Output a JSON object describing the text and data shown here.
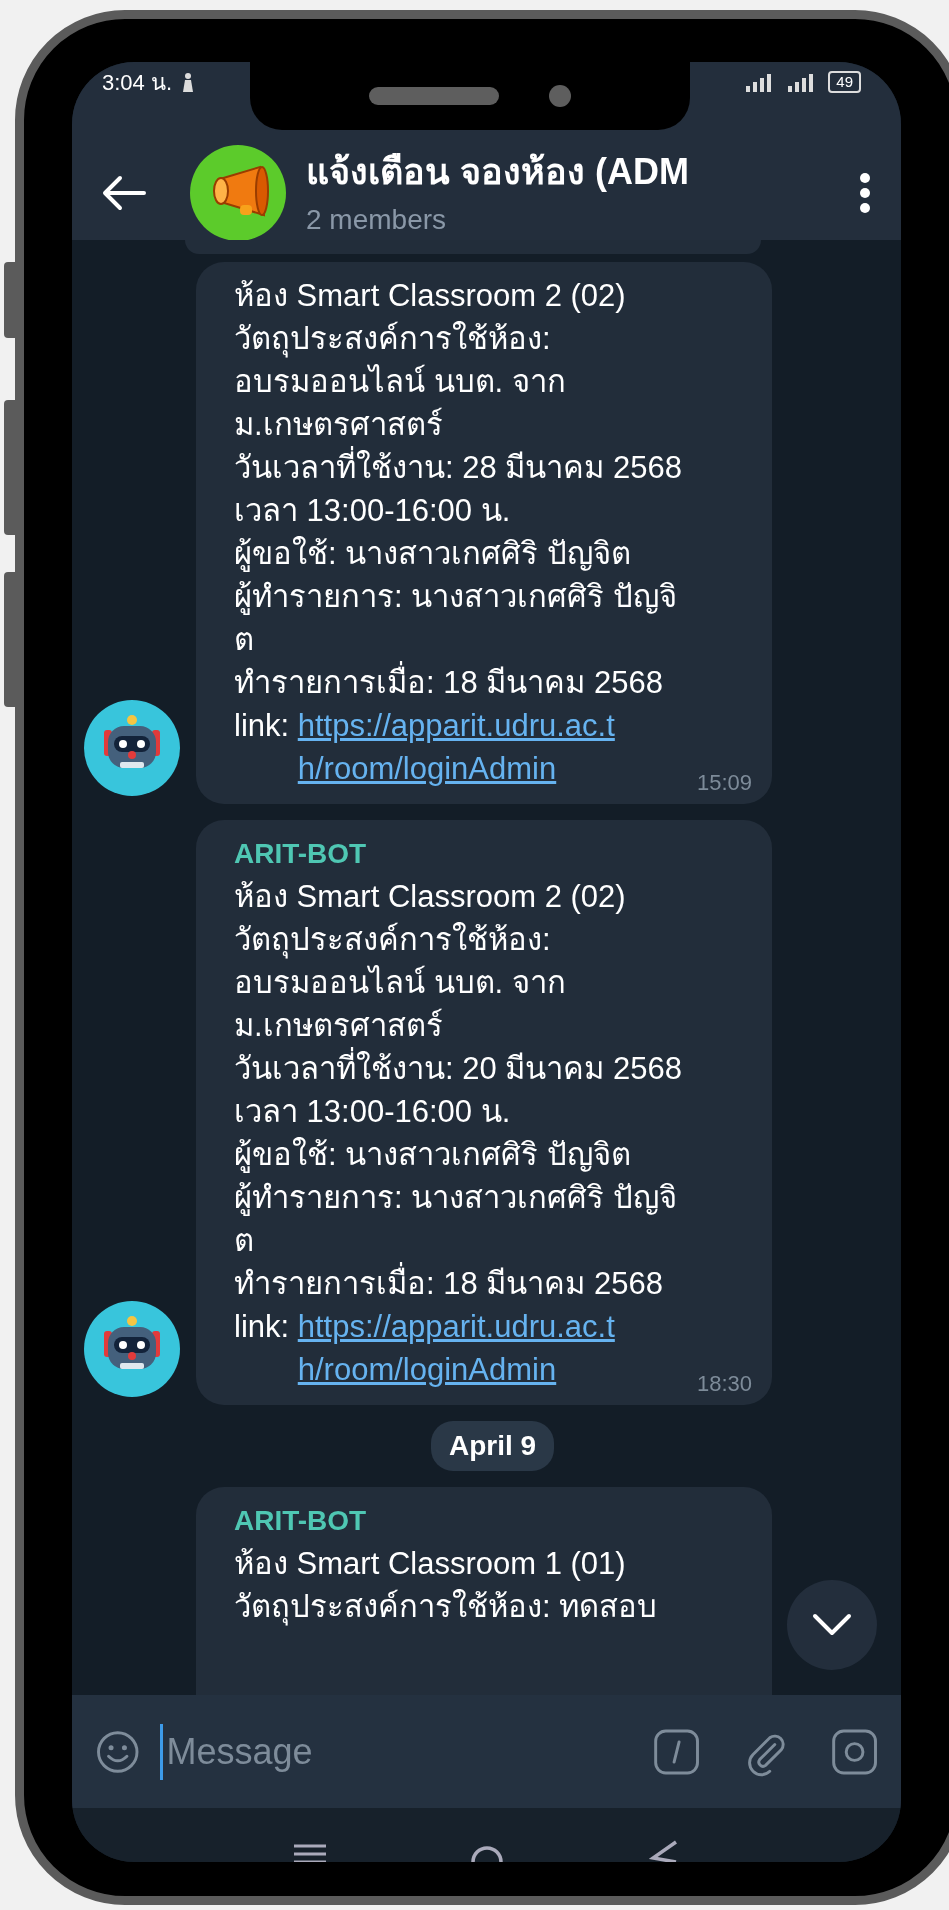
{
  "status_bar": {
    "time": "3:04 น.",
    "battery": "49"
  },
  "header": {
    "title": "แจ้งเตือน จองห้อง (ADM",
    "subtitle": "2 members"
  },
  "chat": [
    {
      "kind": "message",
      "lines": [
        "ห้อง Smart Classroom 2 (02)",
        "วัตถุประสงค์การใช้ห้อง:",
        "อบรมออนไลน์ นบต. จาก",
        "ม.เกษตรศาสตร์",
        "วันเวลาที่ใช้งาน: 28 มีนาคม 2568",
        "เวลา 13:00-16:00 น.",
        "ผู้ขอใช้: นางสาวเกศศิริ ปัญจิต",
        "ผู้ทำรายการ: นางสาวเกศศิริ ปัญจิ",
        "ต",
        "ทำรายการเมื่อ: 18 มีนาคม 2568"
      ],
      "link_label": "link:",
      "link": "https://apparit.udru.ac.th/room/loginAdmin",
      "time": "15:09"
    },
    {
      "kind": "message",
      "sender": "ARIT-BOT",
      "lines": [
        "ห้อง Smart Classroom 2 (02)",
        "วัตถุประสงค์การใช้ห้อง:",
        "อบรมออนไลน์ นบต. จาก",
        "ม.เกษตรศาสตร์",
        "วันเวลาที่ใช้งาน: 20 มีนาคม 2568",
        "เวลา 13:00-16:00 น.",
        "ผู้ขอใช้: นางสาวเกศศิริ ปัญจิต",
        "ผู้ทำรายการ: นางสาวเกศศิริ ปัญจิ",
        "ต",
        "ทำรายการเมื่อ: 18 มีนาคม 2568"
      ],
      "link_label": "link:",
      "link": "https://apparit.udru.ac.th/room/loginAdmin",
      "time": "18:30"
    },
    {
      "kind": "date",
      "text": "April 9"
    },
    {
      "kind": "message",
      "sender": "ARIT-BOT",
      "lines": [
        "ห้อง Smart Classroom 1 (01)",
        "วัตถุประสงค์การใช้ห้อง: ทดสอบ"
      ]
    }
  ],
  "input": {
    "placeholder": "Message"
  }
}
